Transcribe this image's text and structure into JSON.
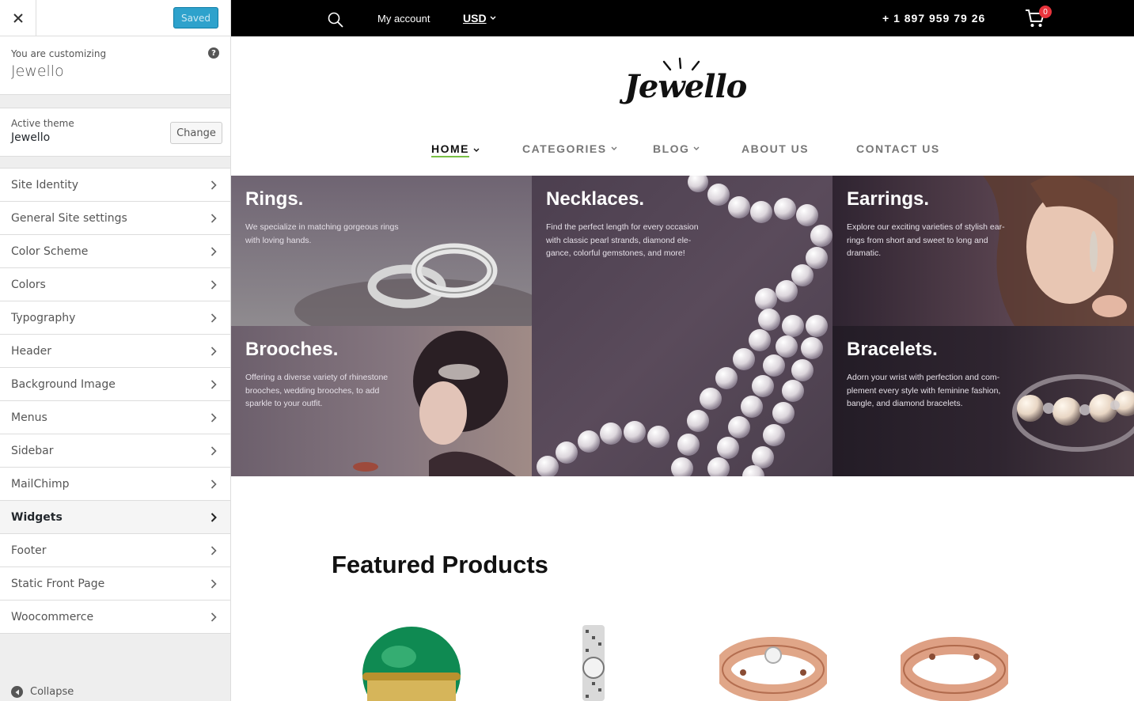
{
  "customizer": {
    "saved_label": "Saved",
    "customizing_label": "You are customizing",
    "site_name": "Jewello",
    "help_glyph": "?",
    "active_theme_label": "Active theme",
    "active_theme_name": "Jewello",
    "change_label": "Change",
    "sections": [
      {
        "label": "Site Identity"
      },
      {
        "label": "General Site settings"
      },
      {
        "label": "Color Scheme"
      },
      {
        "label": "Colors"
      },
      {
        "label": "Typography"
      },
      {
        "label": "Header"
      },
      {
        "label": "Background Image"
      },
      {
        "label": "Menus"
      },
      {
        "label": "Sidebar"
      },
      {
        "label": "MailChimp"
      },
      {
        "label": "Widgets"
      },
      {
        "label": "Footer"
      },
      {
        "label": "Static Front Page"
      },
      {
        "label": "Woocommerce"
      }
    ],
    "active_section": "Widgets",
    "collapse_label": "Collapse",
    "accent_color": "#2ea2cc"
  },
  "site": {
    "topbar": {
      "account_label": "My account",
      "currency": "USD",
      "phone": "+ 1 897 959 79 26",
      "cart_count": "0"
    },
    "logo_text": "Jewello",
    "nav": [
      {
        "label": "HOME",
        "dropdown": true,
        "active": true
      },
      {
        "label": "CATEGORIES",
        "dropdown": true
      },
      {
        "label": "BLOG",
        "dropdown": true
      },
      {
        "label": "ABOUT US"
      },
      {
        "label": "CONTACT US"
      }
    ],
    "nav_accent": "#7ac046",
    "banners": {
      "rings": {
        "title": "Rings.",
        "text": [
          "We specialize in matching gorgeous rings",
          "with loving hands."
        ]
      },
      "necklaces": {
        "title": "Necklaces.",
        "text": [
          "Find the perfect length for every occasion",
          "with classic pearl strands, diamond ele-",
          "gance, colorful gemstones, and more!"
        ]
      },
      "earrings": {
        "title": "Earrings.",
        "text": [
          "Explore our exciting varieties of stylish ear-",
          "rings from short and sweet to long and",
          "dramatic."
        ]
      },
      "brooches": {
        "title": "Brooches.",
        "text": [
          "Offering a diverse variety of rhinestone",
          "brooches, wedding brooches, to add",
          "sparkle to your outfit."
        ]
      },
      "bracelets": {
        "title": "Bracelets.",
        "text": [
          "Adorn your wrist with perfection and com-",
          "plement every style with feminine fashion,",
          "bangle, and diamond bracelets."
        ]
      }
    },
    "featured_title": "Featured Products",
    "products": [
      {
        "name": "emerald-ring-icon"
      },
      {
        "name": "silver-watch-icon"
      },
      {
        "name": "diamond-band-ring-icon"
      },
      {
        "name": "gold-band-ring-icon"
      }
    ]
  }
}
